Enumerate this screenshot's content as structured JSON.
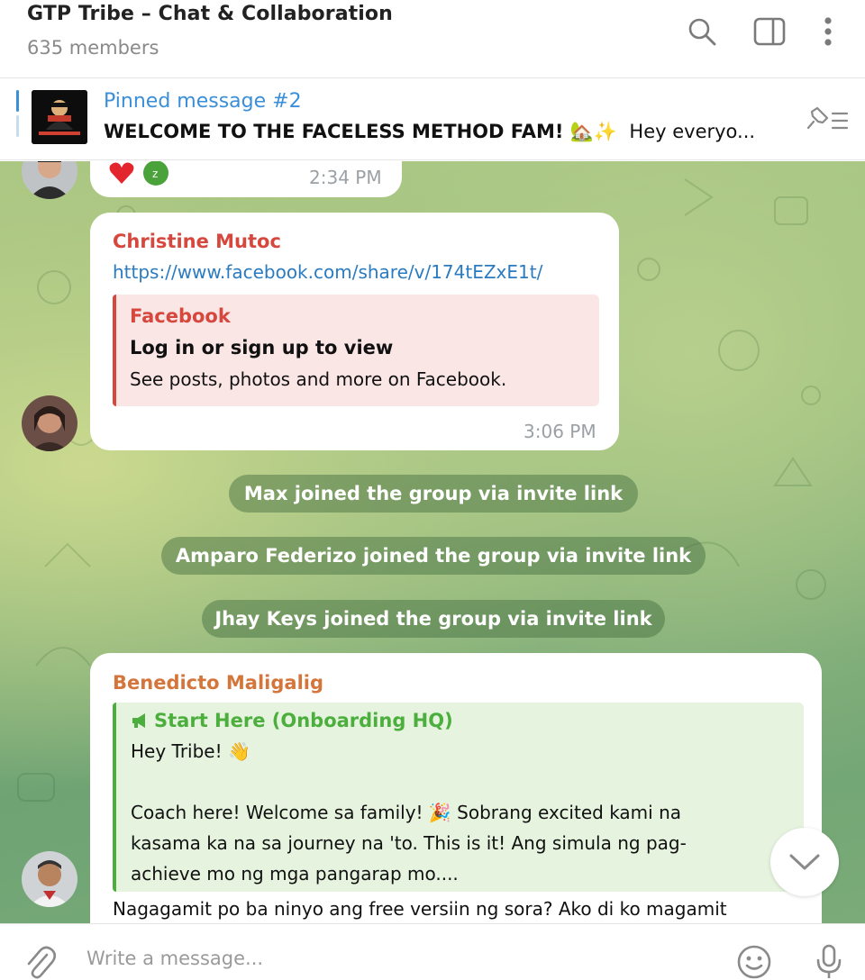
{
  "header": {
    "title": "GTP Tribe – Chat & Collaboration",
    "members": "635 members"
  },
  "pinned": {
    "label": "Pinned message #2",
    "text_bold": "WELCOME TO THE FACELESS METHOD FAM! 🏡✨",
    "text_rest": "Hey everyo..."
  },
  "messages": {
    "m0": {
      "time": "2:34 PM",
      "reactions": [
        "❤️",
        "z"
      ]
    },
    "m1": {
      "sender": "Christine Mutoc",
      "link": "https://www.facebook.com/share/v/174tEZxE1t/",
      "preview": {
        "site": "Facebook",
        "title": "Log in or sign up to view",
        "desc": "See posts, photos and more on Facebook."
      },
      "time": "3:06 PM"
    },
    "services": [
      "Max joined the group via invite link",
      "Amparo Federizo joined the group via invite link",
      "Jhay Keys joined the group via invite link"
    ],
    "m2": {
      "sender": "Benedicto Maligalig",
      "quote_title": "Start Here (Onboarding HQ)",
      "quote_lines": [
        "Hey  Tribe! 👋",
        "Coach here! Welcome sa family! 🎉 Sobrang excited kami na",
        "kasama ka na sa journey na 'to. This is it! Ang simula ng pag-",
        "achieve mo ng mga pangarap mo...."
      ],
      "text": "Nagagamit po ba ninyo ang free versiin ng sora? Ako di ko magamit"
    }
  },
  "composer": {
    "placeholder": "Write a message..."
  },
  "colors": {
    "accent": "#3a8fd8",
    "christine": "#d6473d",
    "benedicto": "#d4763b",
    "quote_green": "#4caf3d"
  }
}
